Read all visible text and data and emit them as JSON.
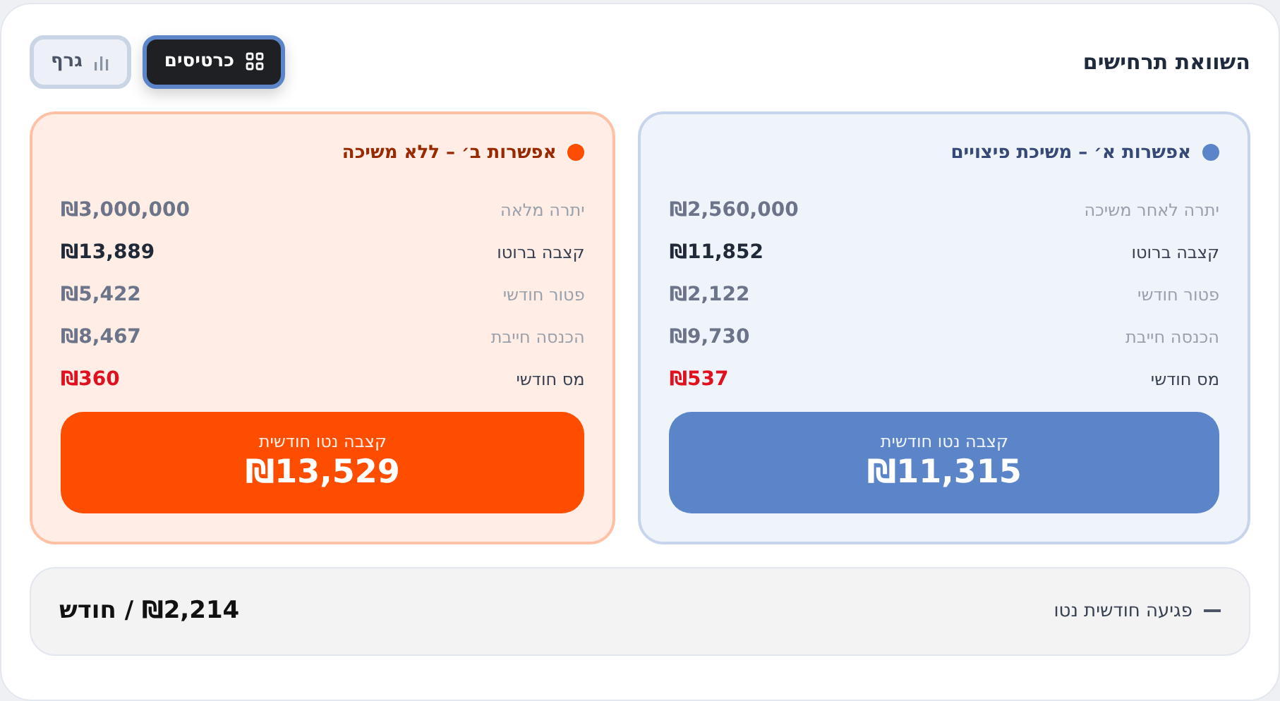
{
  "title": "השוואת תרחישים",
  "view_toggle": [
    {
      "label": "כרטיסים",
      "kind": "grid",
      "selected": true
    },
    {
      "label": "גרף",
      "kind": "bars",
      "selected": false
    }
  ],
  "options": [
    {
      "title": "אפשרות א׳ – משיכת פיצויים",
      "color": "#5b84c9",
      "rows": [
        {
          "label": "יתרה לאחר משיכה",
          "value": "₪2,560,000",
          "kind": "muted"
        },
        {
          "label": "קצבה ברוטו",
          "value": "₪11,852",
          "kind": "strong"
        },
        {
          "label": "פטור חודשי",
          "value": "₪2,122",
          "kind": "muted"
        },
        {
          "label": "הכנסה חייבת",
          "value": "₪9,730",
          "kind": "muted"
        },
        {
          "label": "מס חודשי",
          "value": "₪537",
          "kind": "tax"
        }
      ],
      "net_label": "קצבה נטו חודשית",
      "net_value": "₪11,315"
    },
    {
      "title": "אפשרות ב׳ – ללא משיכה",
      "color": "#ff4d00",
      "rows": [
        {
          "label": "יתרה מלאה",
          "value": "₪3,000,000",
          "kind": "muted"
        },
        {
          "label": "קצבה ברוטו",
          "value": "₪13,889",
          "kind": "strong"
        },
        {
          "label": "פטור חודשי",
          "value": "₪5,422",
          "kind": "muted"
        },
        {
          "label": "הכנסה חייבת",
          "value": "₪8,467",
          "kind": "muted"
        },
        {
          "label": "מס חודשי",
          "value": "₪360",
          "kind": "tax"
        }
      ],
      "net_label": "קצבה נטו חודשית",
      "net_value": "₪13,529"
    }
  ],
  "impact": {
    "label": "פגיעה חודשית נטו",
    "value": "₪2,214 / חודש"
  }
}
